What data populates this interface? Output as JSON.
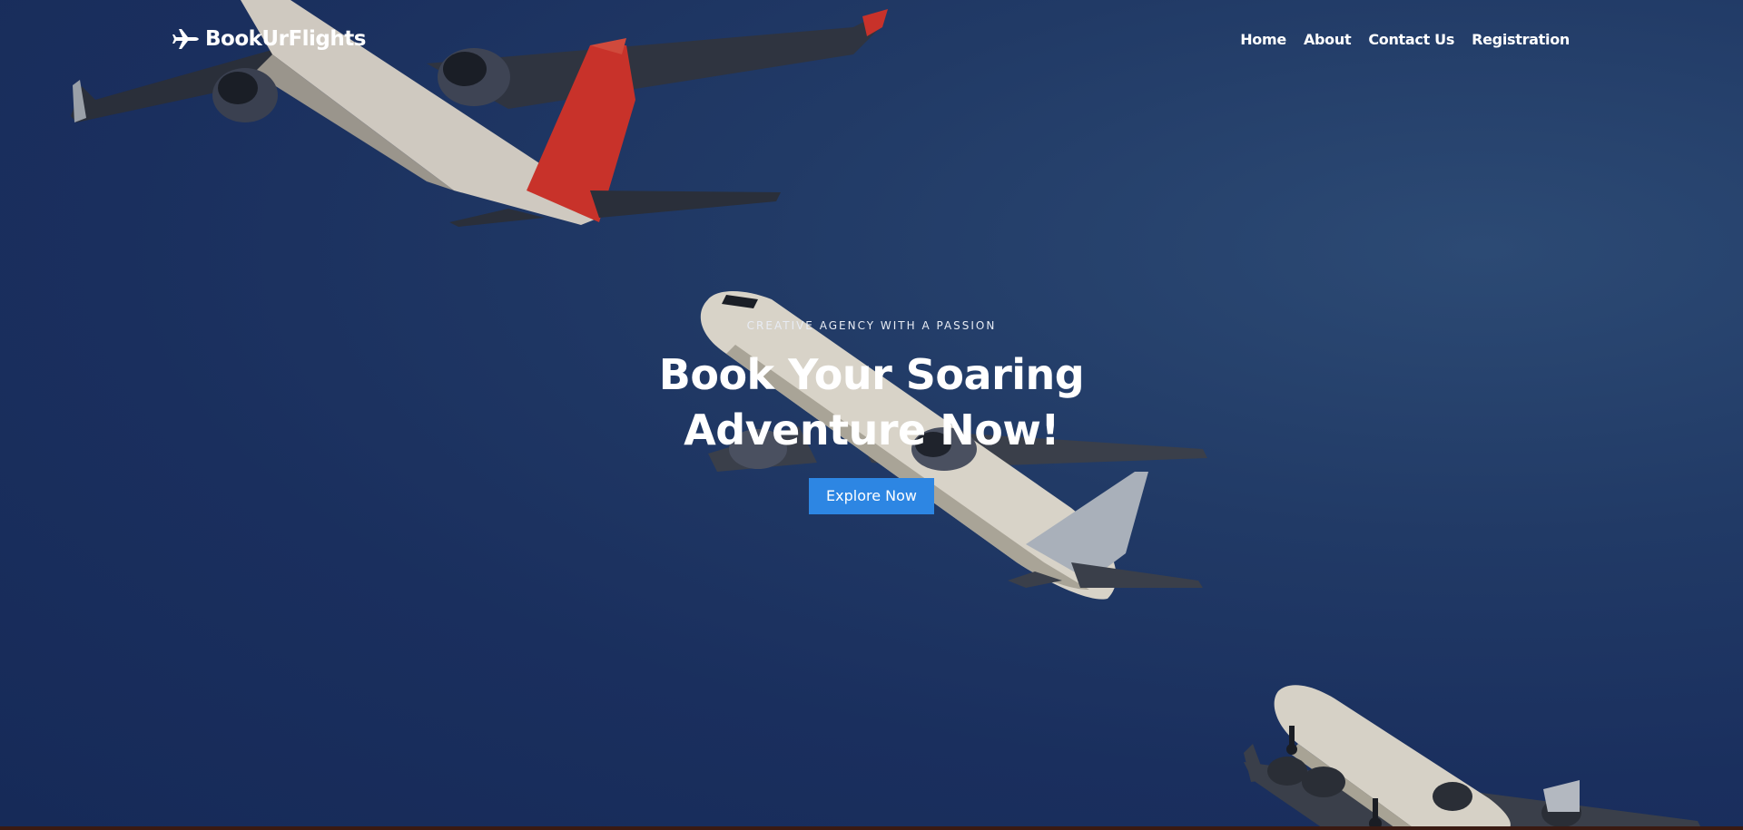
{
  "brand": {
    "name": "BookUrFlights",
    "icon": "airplane-icon"
  },
  "nav": {
    "items": [
      {
        "label": "Home"
      },
      {
        "label": "About"
      },
      {
        "label": "Contact Us"
      },
      {
        "label": "Registration"
      }
    ]
  },
  "hero": {
    "eyebrow": "CREATIVE AGENCY WITH A PASSION",
    "title_line1": "Book Your Soaring",
    "title_line2": "Adventure Now!",
    "cta_label": "Explore Now",
    "background": "photo of three passenger jets in a dark blue sky"
  },
  "colors": {
    "sky": "#1a2f5e",
    "cta": "#2d86e3",
    "text": "#ffffff",
    "qantas_red": "#c8322a"
  }
}
